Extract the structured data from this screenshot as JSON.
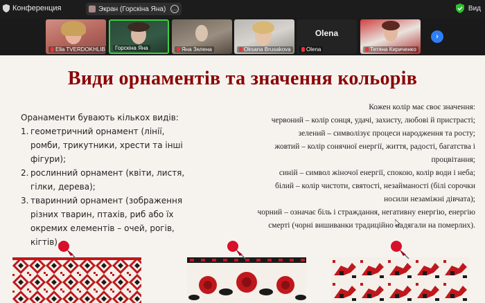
{
  "topbar": {
    "app_name": "Конференция",
    "share_label": "Экран (Горскіна Яна)",
    "more_label": "...",
    "view_label": "Вид"
  },
  "participants": [
    {
      "name": "Ella TVERDOKHLIB"
    },
    {
      "name": "Горскіна Яна"
    },
    {
      "name": "Яна Зелена"
    },
    {
      "name": "Oksana Brusakova"
    },
    {
      "name": "Olena",
      "display": "Olena"
    },
    {
      "name": "Тетяна Кириченко"
    }
  ],
  "slide": {
    "title": "Види орнаментів та значення кольорів",
    "left": {
      "intro": "Оранаменти бувають кількох видів:",
      "items": [
        {
          "num": "1.",
          "text": "геометричний орнамент (лінії, ромби, трикутники, хрести та інші фігури);"
        },
        {
          "num": "2.",
          "text": "рослинний орнамент (квіти, листя, гілки, дерева);"
        },
        {
          "num": "3.",
          "text": "тваринний орнамент (зображення різних тварин, птахів, риб або їх окремих елементів – очей, рогів, кігтів)."
        }
      ]
    },
    "right": {
      "lines": [
        "Кожен колір має своє значення:",
        "червоний – колір сонця, удачі, захисту, любові й пристрасті;",
        "зелений – символізує процеси народження та росту;",
        "жовтий – колір сонячної енергії, життя, радості, багатства і процвітання;",
        "синій – символ жіночої енергії, спокою, колір води і неба;",
        "білий – колір чистоти, святості, незайманості (білі сорочки носили незаміжні дівчата);",
        "чорний – означає біль і страждання, негативну енергію, енергію смерті (чорні вишиванки традиційно надягали на померлих)."
      ]
    }
  },
  "colors": {
    "title_red": "#8b0000",
    "accent_blue": "#2d7ff9",
    "active_speaker": "#3ed13e",
    "pin_red": "#d8102a"
  },
  "icons": [
    "shield-icon",
    "share-screen-icon",
    "more-icon",
    "security-icon",
    "mic-muted-icon",
    "chevron-right-icon",
    "pushpin-icon"
  ]
}
